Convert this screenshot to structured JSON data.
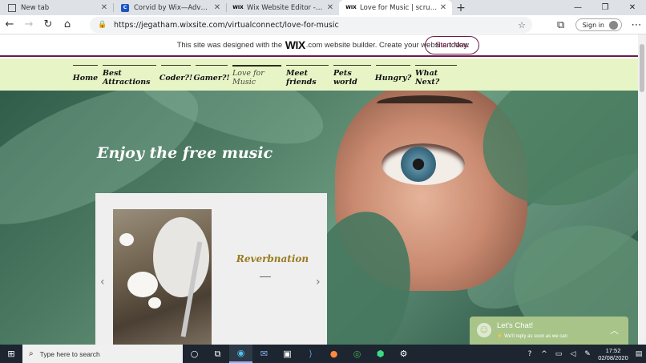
{
  "browser": {
    "tabs": [
      {
        "favicon": "newtab-icon",
        "title": "New tab",
        "active": false
      },
      {
        "favicon": "corvid-icon",
        "title": "Corvid by Wix—Advanced Web",
        "active": false
      },
      {
        "favicon": "wix-icon",
        "title": "Wix Website Editor - virtualconn",
        "active": false
      },
      {
        "favicon": "wix-icon",
        "title": "Love for Music | scrumblog",
        "active": true
      }
    ],
    "url": "https://jegatham.wixsite.com/virtualconnect/love-for-music",
    "signin_label": "Sign in"
  },
  "wix_banner": {
    "text_before": "This site was designed with the",
    "brand": "WIX",
    "text_after": ".com website builder. Create your website today.",
    "button_label": "Start Now"
  },
  "site_nav": {
    "items": [
      {
        "label": "Home",
        "active": false
      },
      {
        "label": "Best Attractions",
        "active": false
      },
      {
        "label": "Coder?!",
        "active": false
      },
      {
        "label": "Gamer?!",
        "active": false
      },
      {
        "label": "Love for Music",
        "active": true
      },
      {
        "label": "Meet friends",
        "active": false
      },
      {
        "label": "Pets world",
        "active": false
      },
      {
        "label": "Hungry?",
        "active": false
      },
      {
        "label": "What Next?",
        "active": false
      }
    ]
  },
  "hero": {
    "title": "Enjoy the free music"
  },
  "card": {
    "title": "Reverbnation"
  },
  "chat": {
    "title": "Let's Chat!",
    "subtitle": "We'll reply as soon as we can"
  },
  "taskbar": {
    "search_placeholder": "Type here to search",
    "time": "17:52",
    "date": "02/08/2020"
  },
  "colors": {
    "nav_bg": "#e7f4c6",
    "banner_accent": "#6d1b4b",
    "card_title": "#9a7a1e",
    "chat_bg": "#a8c488"
  }
}
